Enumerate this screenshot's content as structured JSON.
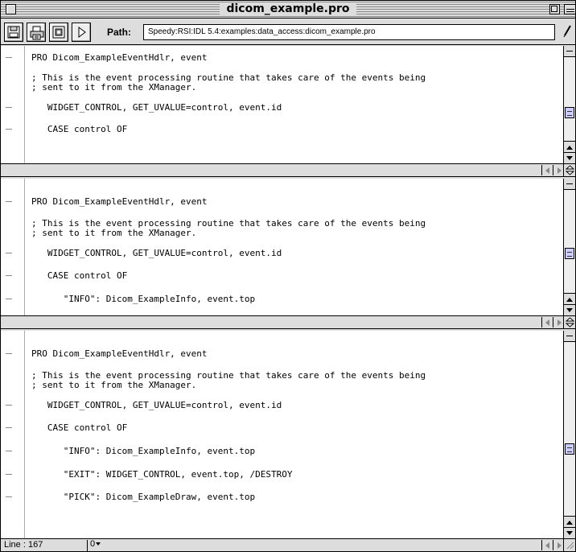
{
  "window": {
    "title": "dicom_example.pro"
  },
  "toolbar": {
    "path_label": "Path:",
    "path_value": "Speedy:RSI:IDL 5.4:examples:data_access:dicom_example.pro",
    "buttons": [
      "save-icon",
      "print-icon",
      "compile-icon",
      "run-icon"
    ]
  },
  "panes": [
    {
      "lines": [
        {
          "text": "PRO Dicom_ExampleEventHdlr, event",
          "marker": true
        },
        {
          "text": "; This is the event processing routine that takes care of the events being",
          "marker": false
        },
        {
          "text": "; sent to it from the XManager.",
          "marker": false
        },
        {
          "text": "   WIDGET_CONTROL, GET_UVALUE=control, event.id",
          "marker": true
        },
        {
          "text": "   CASE control OF",
          "marker": true
        }
      ]
    },
    {
      "lines": [
        {
          "text": "PRO Dicom_ExampleEventHdlr, event",
          "marker": true
        },
        {
          "text": "; This is the event processing routine that takes care of the events being",
          "marker": false
        },
        {
          "text": "; sent to it from the XManager.",
          "marker": false
        },
        {
          "text": "   WIDGET_CONTROL, GET_UVALUE=control, event.id",
          "marker": true
        },
        {
          "text": "   CASE control OF",
          "marker": true
        },
        {
          "text": "      \"INFO\": Dicom_ExampleInfo, event.top",
          "marker": true
        }
      ]
    },
    {
      "lines": [
        {
          "text": "PRO Dicom_ExampleEventHdlr, event",
          "marker": true
        },
        {
          "text": "; This is the event processing routine that takes care of the events being",
          "marker": false
        },
        {
          "text": "; sent to it from the XManager.",
          "marker": false
        },
        {
          "text": "   WIDGET_CONTROL, GET_UVALUE=control, event.id",
          "marker": true
        },
        {
          "text": "   CASE control OF",
          "marker": true
        },
        {
          "text": "      \"INFO\": Dicom_ExampleInfo, event.top",
          "marker": true
        },
        {
          "text": "      \"EXIT\": WIDGET_CONTROL, event.top, /DESTROY",
          "marker": true
        },
        {
          "text": "      \"PICK\": Dicom_ExampleDraw, event.top",
          "marker": true
        }
      ]
    }
  ],
  "status": {
    "line_label": "Line : 167",
    "popup_label": "0"
  }
}
